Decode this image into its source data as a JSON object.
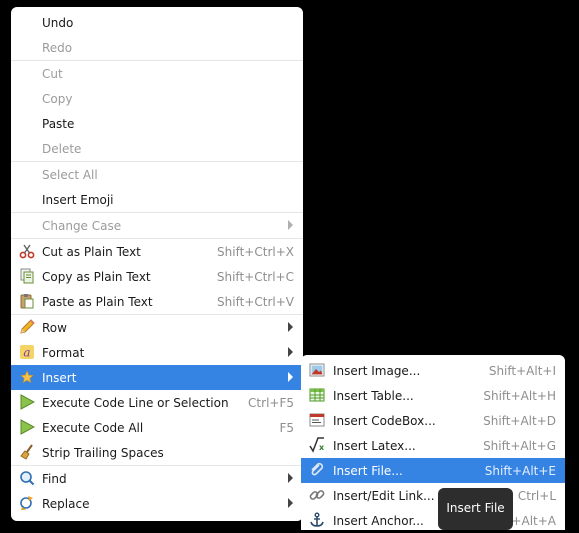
{
  "main_menu": {
    "undo": "Undo",
    "redo": "Redo",
    "cut": "Cut",
    "copy": "Copy",
    "paste": "Paste",
    "delete": "Delete",
    "select_all": "Select All",
    "insert_emoji": "Insert Emoji",
    "change_case": "Change Case",
    "cut_plain": {
      "label": "Cut as Plain Text",
      "shortcut": "Shift+Ctrl+X"
    },
    "copy_plain": {
      "label": "Copy as Plain Text",
      "shortcut": "Shift+Ctrl+C"
    },
    "paste_plain": {
      "label": "Paste as Plain Text",
      "shortcut": "Shift+Ctrl+V"
    },
    "row": "Row",
    "format": "Format",
    "insert": "Insert",
    "exec_line": {
      "label": "Execute Code Line or Selection",
      "shortcut": "Ctrl+F5"
    },
    "exec_all": {
      "label": "Execute Code All",
      "shortcut": "F5"
    },
    "strip_spaces": "Strip Trailing Spaces",
    "find": "Find",
    "replace": "Replace"
  },
  "submenu": {
    "insert_image": {
      "label": "Insert Image...",
      "shortcut": "Shift+Alt+I"
    },
    "insert_table": {
      "label": "Insert Table...",
      "shortcut": "Shift+Alt+H"
    },
    "insert_codebox": {
      "label": "Insert CodeBox...",
      "shortcut": "Shift+Alt+D"
    },
    "insert_latex": {
      "label": "Insert Latex...",
      "shortcut": "Shift+Alt+G"
    },
    "insert_file": {
      "label": "Insert File...",
      "shortcut": "Shift+Alt+E"
    },
    "insert_link": {
      "label": "Insert/Edit Link...",
      "shortcut": "Ctrl+L"
    },
    "insert_anchor": {
      "label": "Insert Anchor...",
      "shortcut": "Shift+Alt+A"
    }
  },
  "tooltip": "Insert File",
  "colors": {
    "highlight": "#3584e4",
    "background": "#000000",
    "menu": "#ffffff"
  }
}
